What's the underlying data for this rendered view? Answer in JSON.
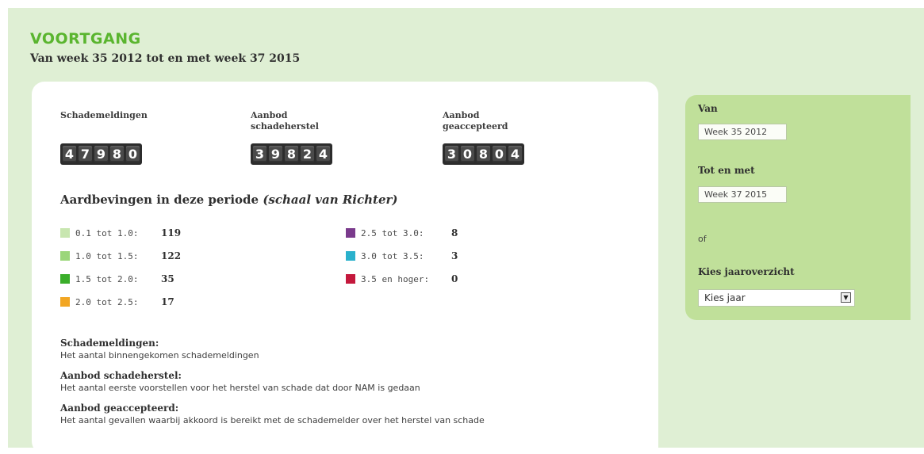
{
  "page": {
    "title": "VOORTGANG",
    "subtitle": "Van week 35 2012 tot en met week 37 2015"
  },
  "counters": [
    {
      "label": "Schademeldingen",
      "digits": [
        "4",
        "7",
        "9",
        "8",
        "0"
      ]
    },
    {
      "label": "Aanbod\nschadeherstel",
      "digits": [
        "3",
        "9",
        "8",
        "2",
        "4"
      ]
    },
    {
      "label": "Aanbod\ngeaccepteerd",
      "digits": [
        "3",
        "0",
        "8",
        "0",
        "4"
      ]
    }
  ],
  "earthquakes": {
    "heading": "Aardbevingen in deze periode",
    "heading_italic": "(schaal van Richter)",
    "items": [
      {
        "range": "0.1 tot 1.0:",
        "count": "119",
        "color": "#c8e6b0"
      },
      {
        "range": "1.0 tot 1.5:",
        "count": "122",
        "color": "#9bd67a"
      },
      {
        "range": "1.5 tot 2.0:",
        "count": "35",
        "color": "#3aae2a"
      },
      {
        "range": "2.0 tot 2.5:",
        "count": "17",
        "color": "#f2a623"
      },
      {
        "range": "2.5 tot 3.0:",
        "count": "8",
        "color": "#7a3a8c"
      },
      {
        "range": "3.0 tot 3.5:",
        "count": "3",
        "color": "#2ab1cc"
      },
      {
        "range": "3.5 en hoger:",
        "count": "0",
        "color": "#c4183c"
      }
    ]
  },
  "definitions": [
    {
      "title": "Schademeldingen:",
      "text": "Het aantal binnengekomen schademeldingen"
    },
    {
      "title": "Aanbod schadeherstel:",
      "text": "Het aantal eerste voorstellen voor het herstel van schade dat door NAM is gedaan"
    },
    {
      "title": "Aanbod geaccepteerd:",
      "text": "Het aantal gevallen waarbij akkoord is bereikt met de schademelder over het herstel van schade"
    }
  ],
  "filter": {
    "from_label": "Van",
    "from_value": "Week 35 2012",
    "to_label": "Tot en met",
    "to_value": "Week 37 2015",
    "or_text": "of",
    "year_label": "Kies jaaroverzicht",
    "year_select": "Kies jaar"
  }
}
